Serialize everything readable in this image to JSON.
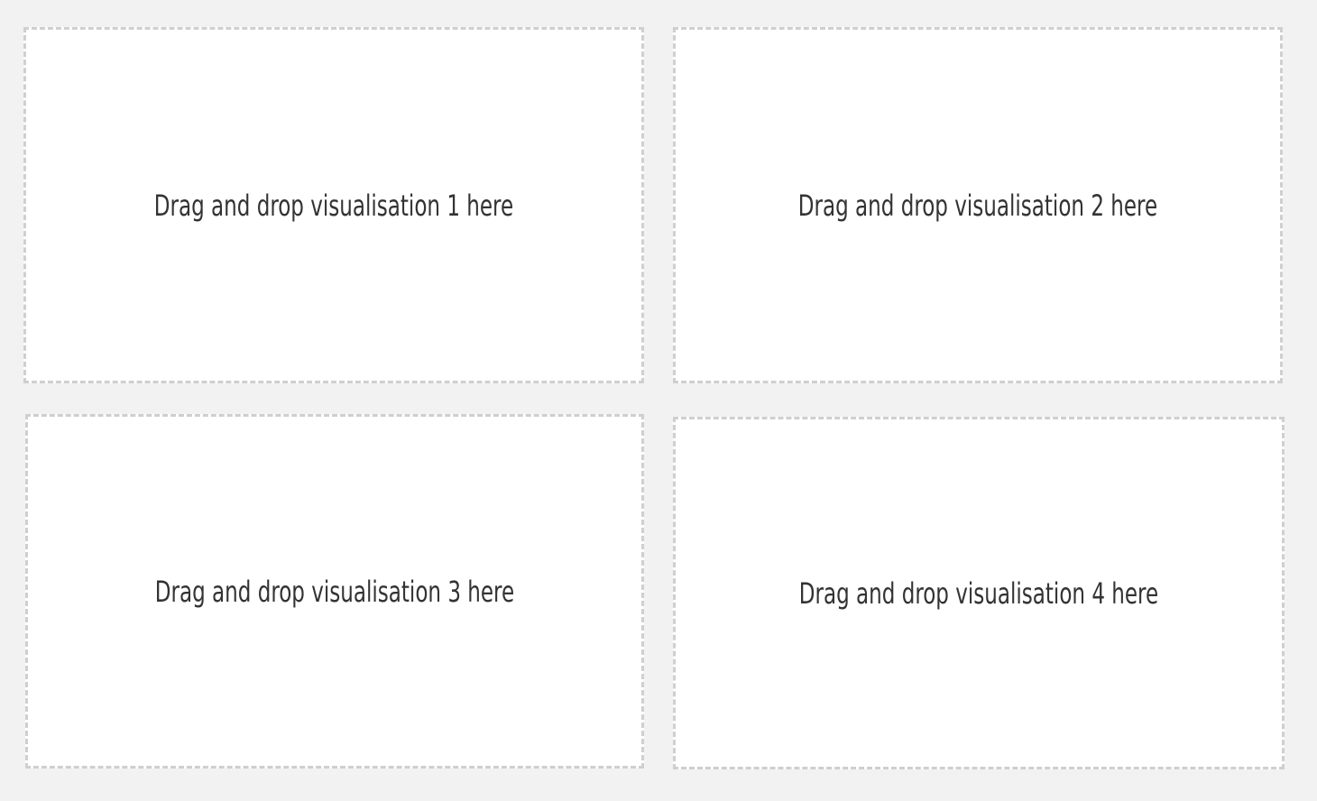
{
  "dashboard": {
    "dropzones": [
      {
        "label": "Drag and drop visualisation 1 here"
      },
      {
        "label": "Drag and drop visualisation 2 here"
      },
      {
        "label": "Drag and drop visualisation 3 here"
      },
      {
        "label": "Drag and drop visualisation 4 here"
      }
    ]
  },
  "colors": {
    "background": "#f2f2f2",
    "panel": "#ffffff",
    "dashed_border": "#cfcfcf",
    "text": "#333333"
  }
}
